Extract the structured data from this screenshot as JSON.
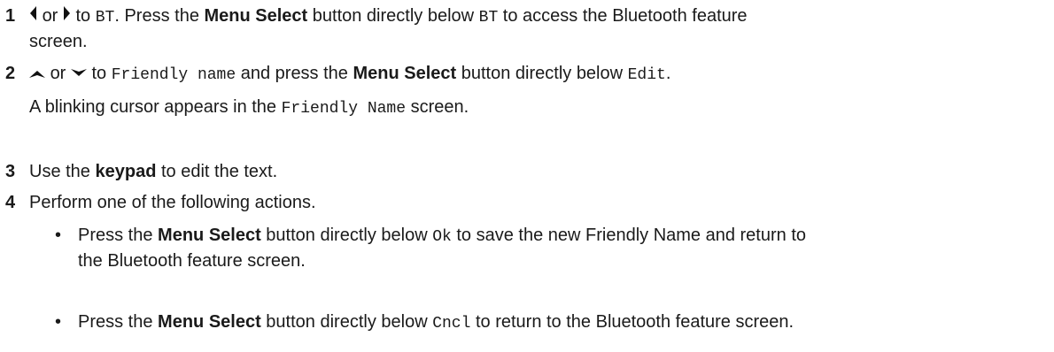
{
  "steps": [
    {
      "number": "1",
      "or": "or",
      "to": "to",
      "code_bt": "BT",
      "text_a": ". Press the ",
      "bold_menu_select": "Menu Select",
      "text_b": " button directly below ",
      "code_bt2": "BT",
      "text_c": " to access the Bluetooth feature",
      "text_d": "screen."
    },
    {
      "number": "2",
      "or": "or",
      "to": "to",
      "code_friendly": "Friendly name",
      "text_a": " and press the ",
      "bold_menu_select": "Menu Select",
      "text_b": " button directly below ",
      "code_edit": "Edit",
      "text_c": ".",
      "sub_a": "A blinking cursor appears in the ",
      "sub_code": "Friendly Name",
      "sub_b": " screen."
    },
    {
      "number": "3",
      "text_a": "Use the ",
      "bold_keypad": "keypad",
      "text_b": " to edit the text."
    },
    {
      "number": "4",
      "text_a": "Perform one of the following actions.",
      "bullets": [
        {
          "marker": "•",
          "text_a": "Press the ",
          "bold": "Menu Select",
          "text_b": " button directly below ",
          "code": "Ok",
          "text_c": " to save the new Friendly Name and return to",
          "text_d": "the Bluetooth feature screen."
        },
        {
          "marker": "•",
          "text_a": "Press the ",
          "bold": "Menu Select",
          "text_b": " button directly below ",
          "code": "Cncl",
          "text_c": " to return to the Bluetooth feature screen."
        }
      ]
    }
  ],
  "icons": [
    "left-arrow-icon",
    "right-arrow-icon",
    "up-arrow-icon",
    "down-arrow-icon"
  ]
}
